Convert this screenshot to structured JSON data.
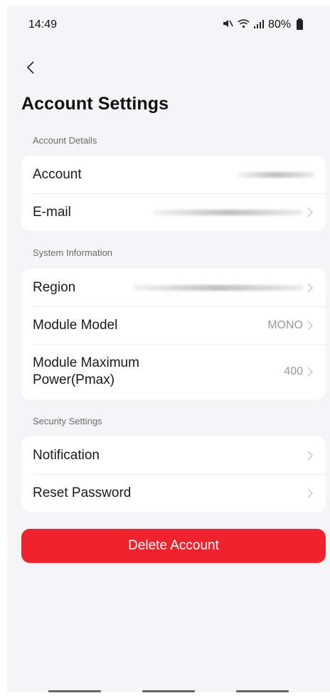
{
  "status_bar": {
    "time": "14:49",
    "battery": "80%",
    "icons": [
      "mute-icon",
      "wifi-icon",
      "signal-icon",
      "battery-icon"
    ]
  },
  "header": {
    "back_icon": "chevron-left-icon",
    "title": "Account Settings"
  },
  "sections": {
    "account_details": {
      "label": "Account Details",
      "rows": {
        "account": {
          "label": "Account"
        },
        "email": {
          "label": "E-mail"
        }
      }
    },
    "system_information": {
      "label": "System Information",
      "rows": {
        "region": {
          "label": "Region"
        },
        "module_model": {
          "label": "Module Model",
          "value": "MONO"
        },
        "module_max_power": {
          "label": "Module Maximum Power(Pmax)",
          "value": "400"
        }
      }
    },
    "security_settings": {
      "label": "Security Settings",
      "rows": {
        "notification": {
          "label": "Notification"
        },
        "reset_password": {
          "label": "Reset Password"
        }
      }
    }
  },
  "delete_button": {
    "label": "Delete Account"
  },
  "colors": {
    "accent_red": "#f0232d",
    "background": "#f5f5f7",
    "card": "#ffffff",
    "muted_text": "#9a9a9a"
  }
}
